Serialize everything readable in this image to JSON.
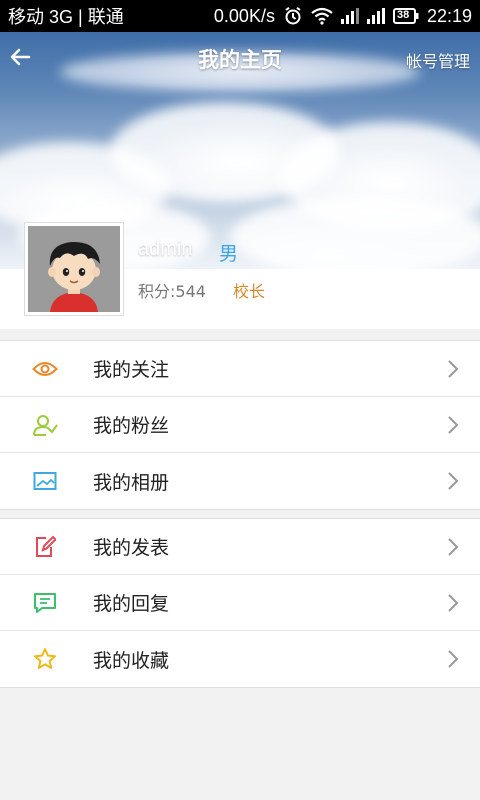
{
  "status_bar": {
    "carrier": "移动 3G | 联通",
    "speed": "0.00K/s",
    "battery": "38",
    "time": "22:19"
  },
  "nav": {
    "title": "我的主页",
    "account_button": "帐号管理"
  },
  "profile": {
    "username": "admin",
    "gender": "男",
    "points": "积分:544",
    "rank": "校长"
  },
  "menu_groups": [
    [
      {
        "label": "我的关注",
        "icon": "eye-icon",
        "color": "#e8892b"
      },
      {
        "label": "我的粉丝",
        "icon": "add-user-icon",
        "color": "#9ccc3a"
      },
      {
        "label": "我的相册",
        "icon": "image-icon",
        "color": "#3fa9dc"
      }
    ],
    [
      {
        "label": "我的发表",
        "icon": "edit-icon",
        "color": "#e24a5a"
      },
      {
        "label": "我的回复",
        "icon": "comment-icon",
        "color": "#3bbf6b"
      },
      {
        "label": "我的收藏",
        "icon": "star-icon",
        "color": "#f1b81e"
      }
    ]
  ],
  "colors": {
    "gender": "#3aa6e8",
    "rank": "#d58a2b"
  }
}
